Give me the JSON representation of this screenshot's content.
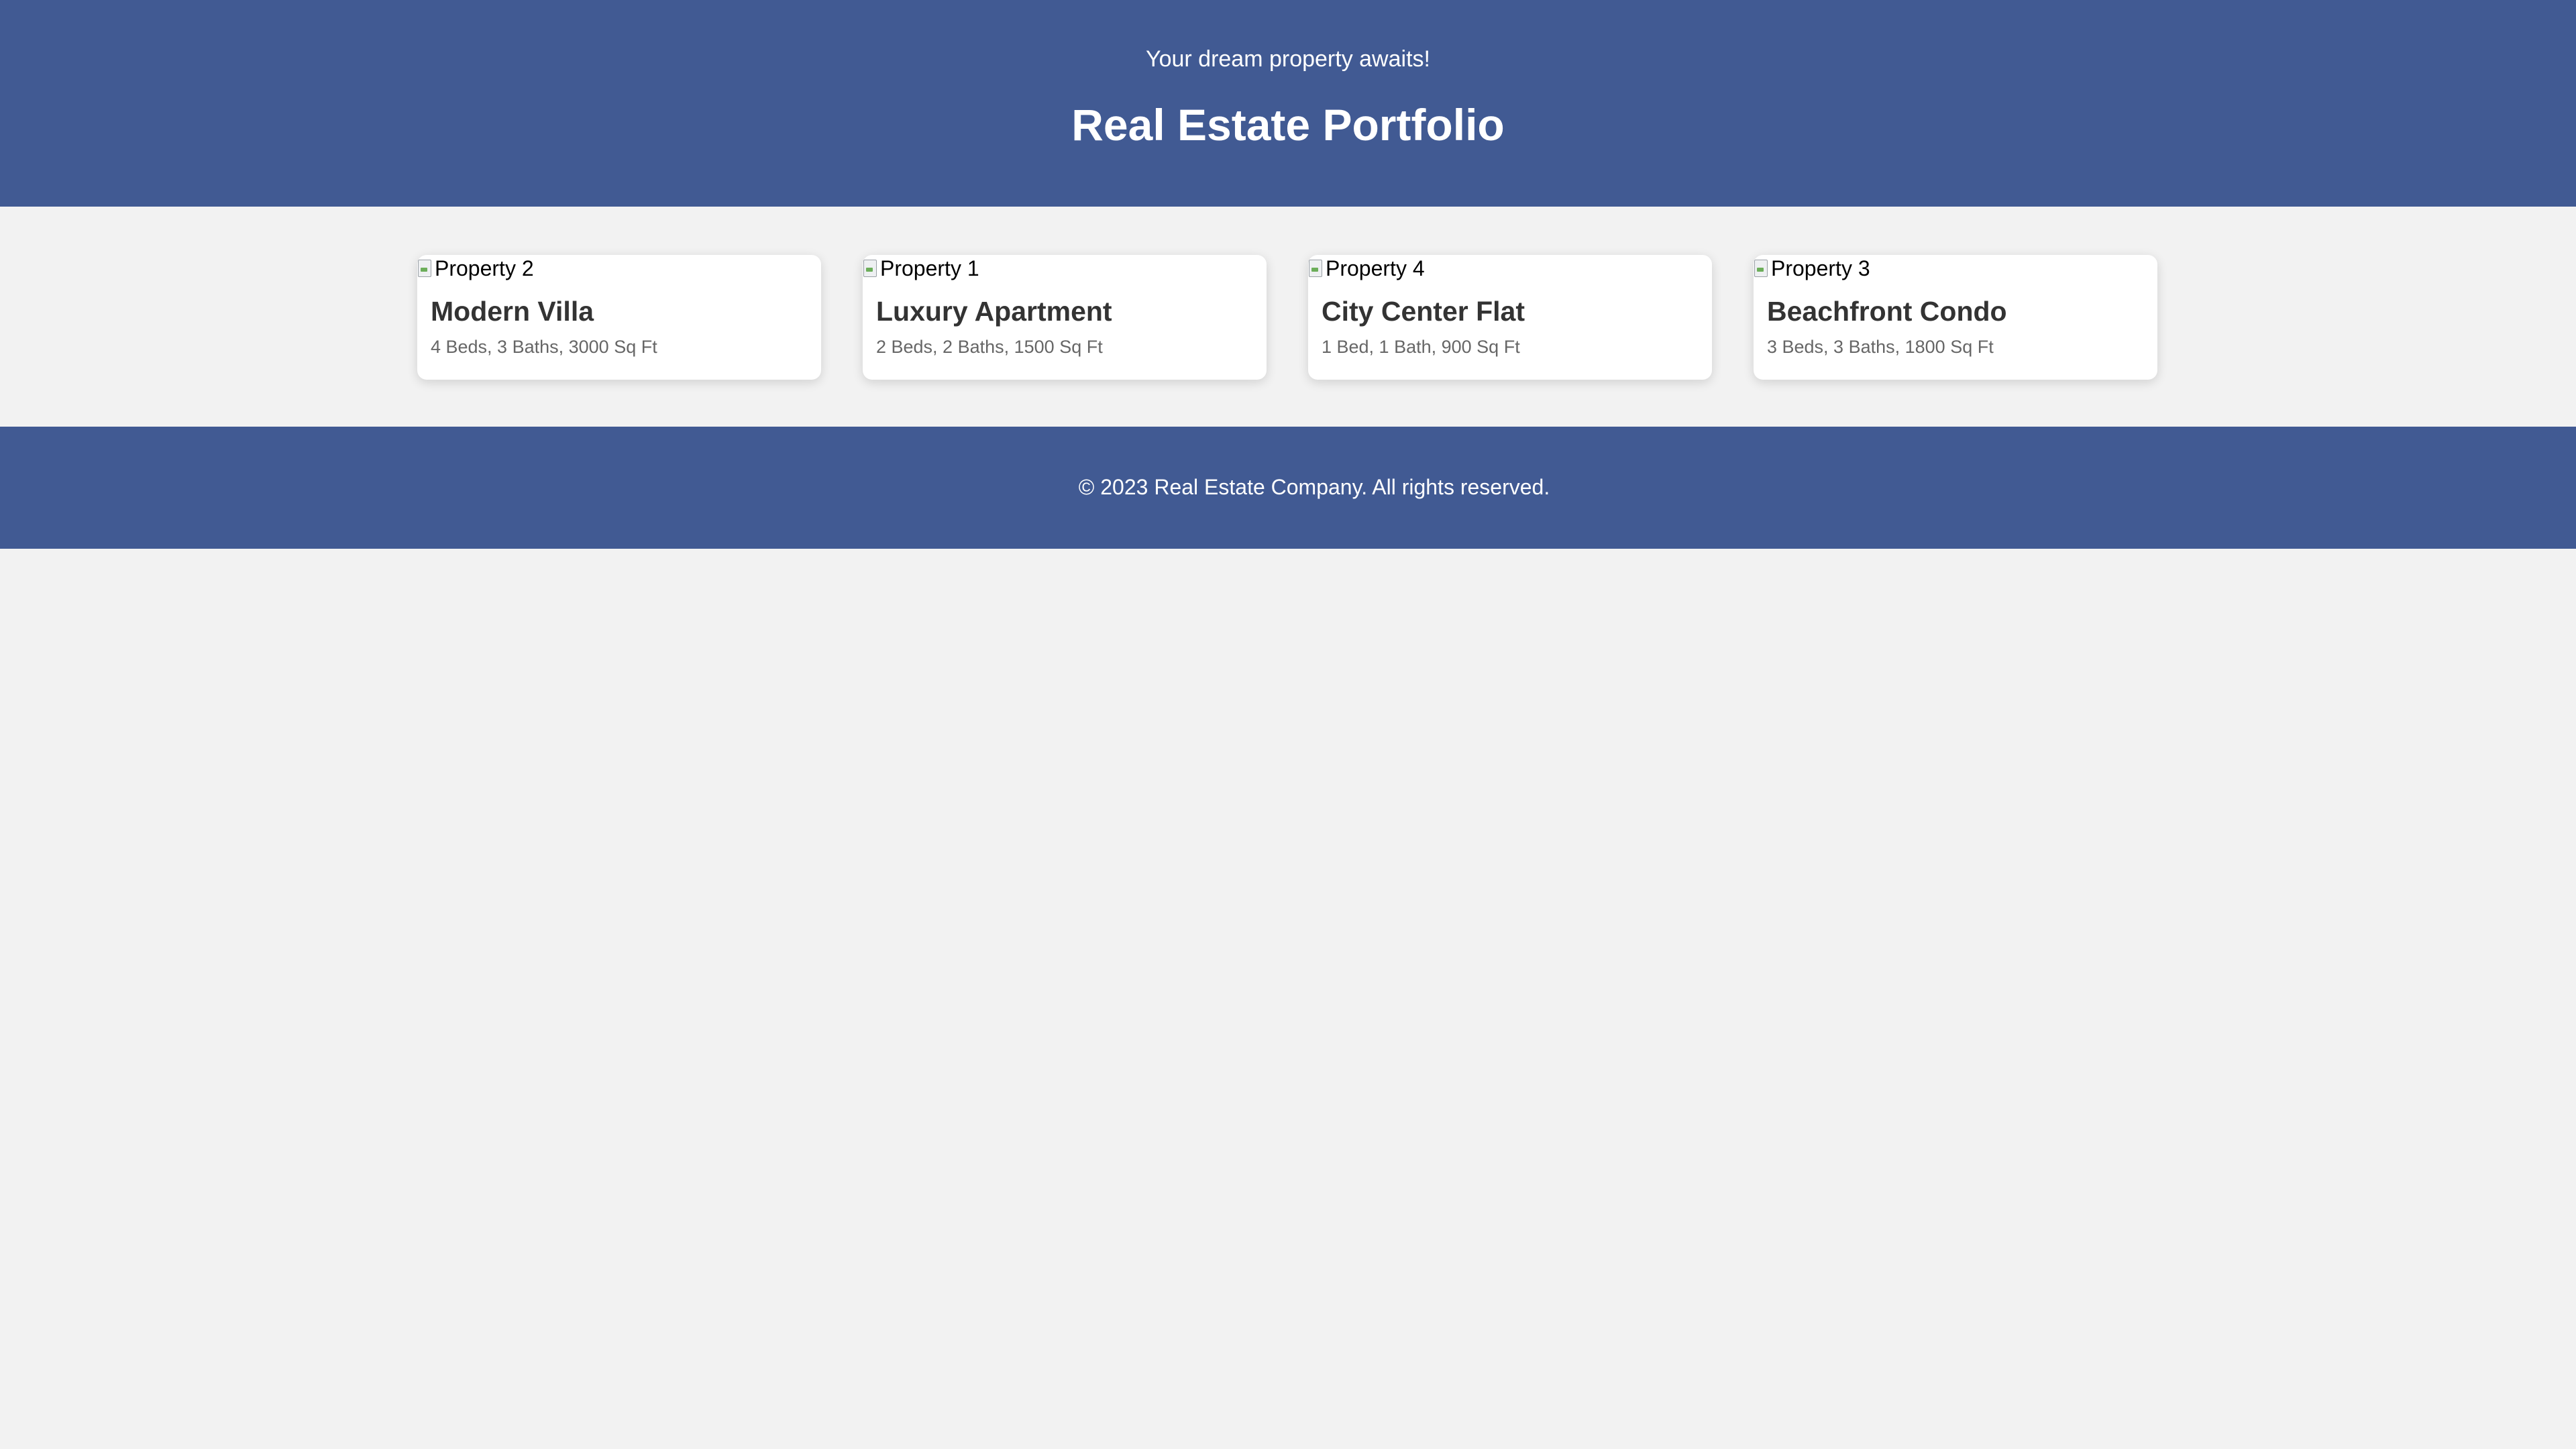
{
  "header": {
    "tagline": "Your dream property awaits!",
    "title": "Real Estate Portfolio"
  },
  "properties": [
    {
      "image_alt": "Property 2",
      "name": "Modern Villa",
      "details": "4 Beds, 3 Baths, 3000 Sq Ft"
    },
    {
      "image_alt": "Property 1",
      "name": "Luxury Apartment",
      "details": "2 Beds, 2 Baths, 1500 Sq Ft"
    },
    {
      "image_alt": "Property 4",
      "name": "City Center Flat",
      "details": "1 Bed, 1 Bath, 900 Sq Ft"
    },
    {
      "image_alt": "Property 3",
      "name": "Beachfront Condo",
      "details": "3 Beds, 3 Baths, 1800 Sq Ft"
    }
  ],
  "footer": {
    "copyright": "© 2023 Real Estate Company. All rights reserved."
  },
  "colors": {
    "brand": "#415a93",
    "background": "#f2f2f2",
    "card_background": "#ffffff"
  }
}
